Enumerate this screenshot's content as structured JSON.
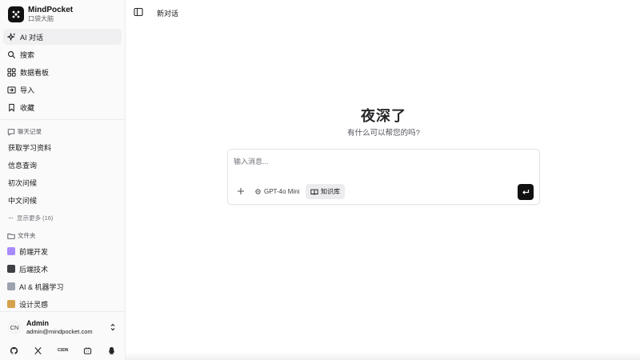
{
  "brand": {
    "name": "MindPocket",
    "subtitle": "口袋大脑"
  },
  "nav": [
    {
      "label": "AI 对话",
      "icon": "sparkles-icon",
      "active": true
    },
    {
      "label": "搜索",
      "icon": "search-icon"
    },
    {
      "label": "数据看板",
      "icon": "dashboard-icon"
    },
    {
      "label": "导入",
      "icon": "import-icon"
    },
    {
      "label": "收藏",
      "icon": "bookmark-icon"
    }
  ],
  "chat_history": {
    "title": "聊天记录",
    "items": [
      "获取学习资料",
      "信息查询",
      "初次问候",
      "中文问候"
    ],
    "more_label": "显示更多 (16)"
  },
  "folders": {
    "title": "文件夹",
    "items": [
      {
        "label": "前端开发",
        "icon": "atom-emoji-icon",
        "color": "#a78bfa"
      },
      {
        "label": "后端技术",
        "icon": "desktop-emoji-icon",
        "color": "#3f3f46"
      },
      {
        "label": "AI & 机器学习",
        "icon": "robot-emoji-icon",
        "color": "#9ca3af"
      },
      {
        "label": "设计灵感",
        "icon": "palette-emoji-icon",
        "color": "#d4a24c"
      }
    ]
  },
  "user": {
    "initials": "CN",
    "name": "Admin",
    "email": "admin@mindpocket.com"
  },
  "footer": {
    "csdn_label": "CSDN"
  },
  "topbar": {
    "title": "新对话"
  },
  "greeting": {
    "title": "夜深了",
    "subtitle": "有什么可以帮您的吗?"
  },
  "composer": {
    "placeholder": "输入消息...",
    "model_label": "GPT-4o Mini",
    "kb_label": "知识库"
  },
  "colors": {
    "accent": "#111111",
    "sidebar_bg": "#fafafa",
    "active_bg": "#f0f0f2"
  }
}
